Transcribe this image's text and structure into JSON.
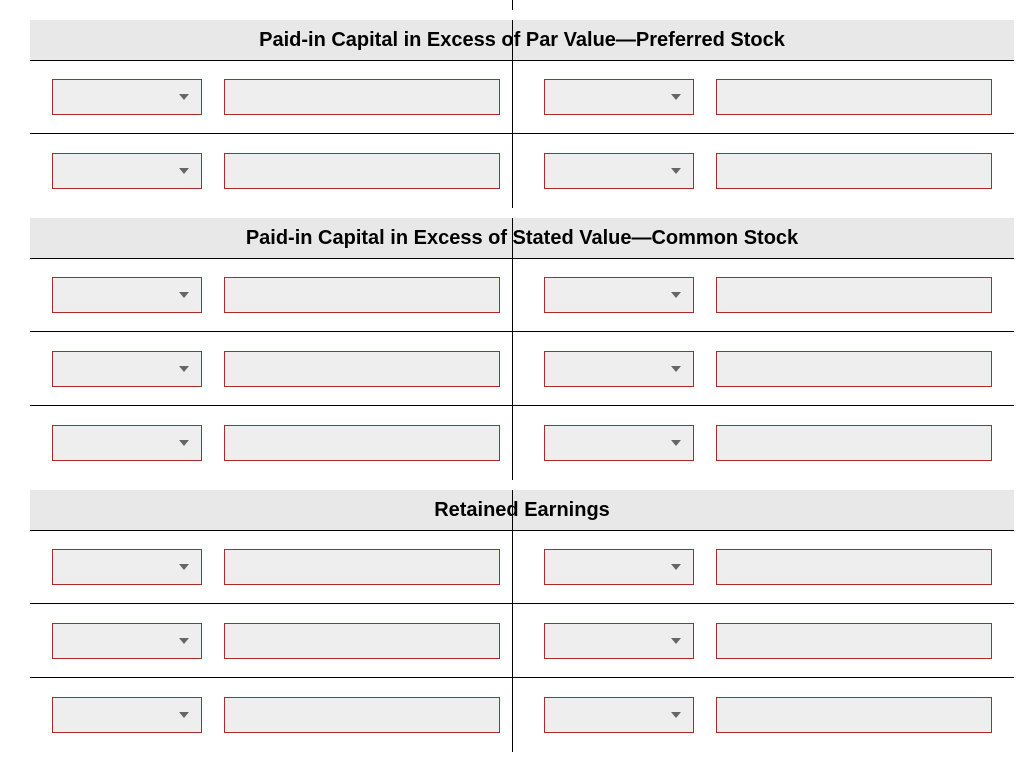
{
  "sections": [
    {
      "title": "Paid-in Capital in Excess of Par Value—Preferred Stock",
      "rows": 2
    },
    {
      "title": "Paid-in Capital in Excess of Stated Value—Common Stock",
      "rows": 3
    },
    {
      "title": "Retained Earnings",
      "rows": 3
    }
  ],
  "colors": {
    "input_border": "#aa2b2b",
    "header_bg": "#e8e8e8"
  }
}
